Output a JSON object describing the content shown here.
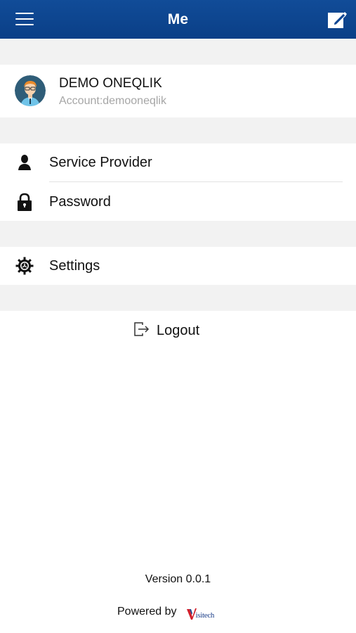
{
  "header": {
    "title": "Me",
    "menu_icon": "hamburger-menu-icon",
    "edit_icon": "edit-pencil-icon",
    "background_color": "#0d4592"
  },
  "profile": {
    "name": "DEMO ONEQLIK",
    "account": "Account:demooneqlik",
    "avatar_icon": "user-avatar-icon"
  },
  "menu": {
    "service_provider": {
      "label": "Service Provider",
      "icon": "person-icon"
    },
    "password": {
      "label": "Password",
      "icon": "lock-icon"
    },
    "settings": {
      "label": "Settings",
      "icon": "gear-icon"
    }
  },
  "logout": {
    "label": "Logout",
    "icon": "logout-icon"
  },
  "footer": {
    "version": "Version 0.0.1",
    "powered_by": "Powered by",
    "brand": "isitech",
    "brand_color": "#1c3f8a",
    "brand_accent": "#d21f2b"
  },
  "colors": {
    "section_gap": "#f2f2f2",
    "secondary_text": "#a6a6a6"
  }
}
